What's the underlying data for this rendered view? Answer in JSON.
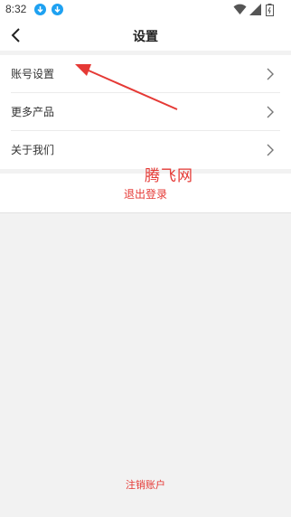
{
  "status_bar": {
    "time": "8:32",
    "icons": [
      "download-icon",
      "download-icon",
      "wifi-icon",
      "signal-icon",
      "battery-icon"
    ]
  },
  "header": {
    "title": "设置",
    "back_icon": "chevron-left-icon"
  },
  "menu": {
    "items": [
      {
        "label": "账号设置",
        "icon": "chevron-right-icon"
      },
      {
        "label": "更多产品",
        "icon": "chevron-right-icon"
      },
      {
        "label": "关于我们",
        "icon": "chevron-right-icon"
      }
    ]
  },
  "logout_label": "退出登录",
  "watermark": "腾飞网",
  "cancel_account_label": "注销账户",
  "colors": {
    "accent_red": "#e53935",
    "download_blue": "#1ea1f1",
    "background": "#f2f2f2"
  }
}
